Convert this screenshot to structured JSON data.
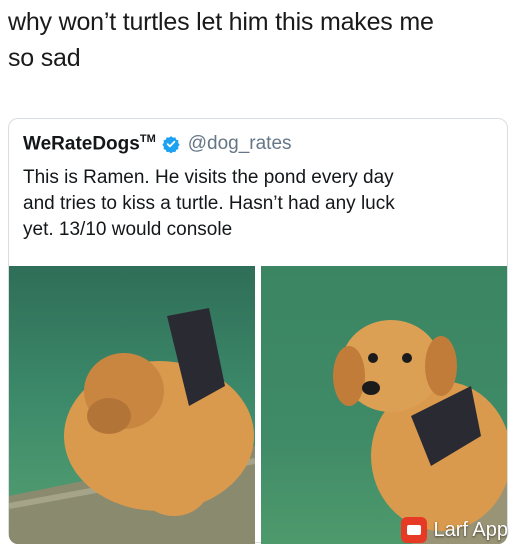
{
  "caption": {
    "line1": "why won’t turtles let him this makes me",
    "line2": "so sad"
  },
  "tweet": {
    "display_name": "WeRateDogs",
    "trademark": "TM",
    "verified_icon": "verified-badge-icon",
    "handle": "@dog_rates",
    "text_line1": "This is Ramen. He visits the pond every day",
    "text_line2": "and tries to kiss a turtle. Hasn’t had any luck",
    "text_line3": "yet. 13/10 would console"
  },
  "watermark": {
    "text": "Larf App",
    "icon": "larf-logo-icon"
  },
  "colors": {
    "verified": "#1da1f2",
    "handle": "#657786",
    "water": "#3f8a6a",
    "puppy": "#d99a4e",
    "collar": "#2a2a33",
    "watermark_logo": "#e63a24"
  }
}
